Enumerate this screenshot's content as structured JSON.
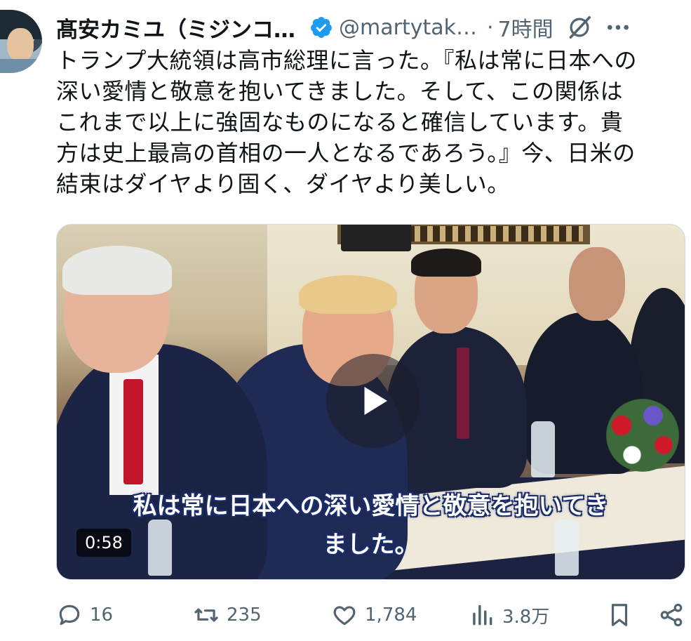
{
  "author": {
    "name": "髙安カミユ（ミジンコ…",
    "handle": "@martytak…",
    "separator": "·",
    "time": "7時間"
  },
  "tweet": {
    "lines": [
      "トランプ大統領は高市総理に言った。『私は常に日本への",
      "深い愛情と敬意を抱いてきました。そして、この関係は",
      "これまで以上に強固なものになると確信しています。貴",
      "方は史上最高の首相の一人となるであろう。』今、日米の",
      "結束はダイヤより固く、ダイヤより美しい。"
    ]
  },
  "video": {
    "subtitle_line1": "私は常に日本への深い愛情と敬意を抱いてき",
    "subtitle_line2": "ました。",
    "duration": "0:58"
  },
  "actions": {
    "replies": "16",
    "reposts": "235",
    "likes": "1,784",
    "views": "3.8万"
  },
  "icons": {
    "verified": "verified-badge-icon",
    "grok": "grok-icon",
    "more": "more-icon",
    "reply": "reply-icon",
    "repost": "repost-icon",
    "like": "heart-icon",
    "views": "views-icon",
    "bookmark": "bookmark-icon",
    "share": "share-icon",
    "play": "play-icon"
  },
  "colors": {
    "verified": "#1d9bf0",
    "secondary_text": "#536471",
    "primary_text": "#0f1419"
  }
}
